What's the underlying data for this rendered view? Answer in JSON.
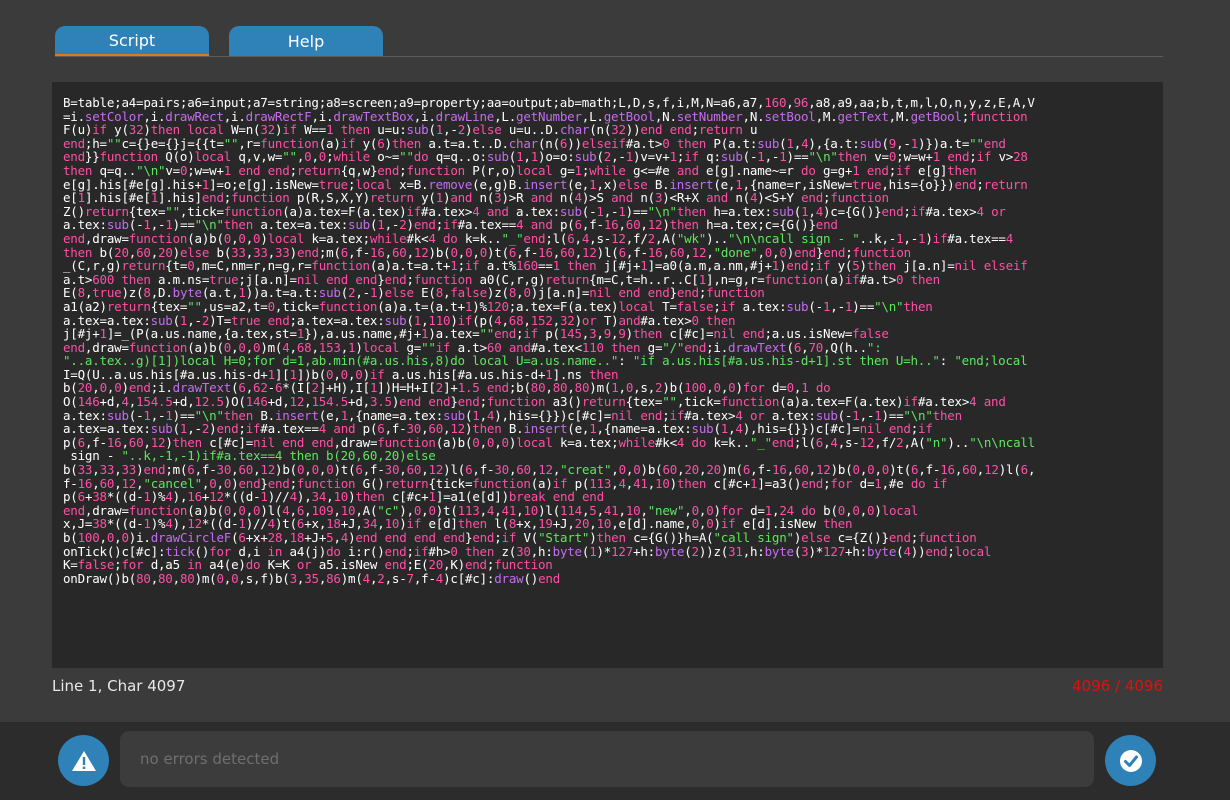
{
  "tabs": [
    {
      "label": "Script",
      "active": true
    },
    {
      "label": "Help",
      "active": false
    }
  ],
  "editor": {
    "lines": [
      "B=table;a4=pairs;a6=input;a7=string;a8=screen;a9=property;aa=output;ab=math;L,D,s,f,i,M,N=a6,a7,160,96,a8,a9,aa;b,t,m,l,O,n,y,z,E,A,V",
      "=i.setColor,i.drawRect,i.drawRectF,i.drawTextBox,i.drawLine,L.getNumber,L.getBool,N.setNumber,N.setBool,M.getText,M.getBool;function",
      "F(u)if y(32)then local W=n(32)if W==1 then u=u:sub(1,-2)else u=u..D.char(n(32))end end;return u",
      "end;h=\"\"c={}e={}j={{t=\"\",r=function(a)if y(6)then a.t=a.t..D.char(n(6))elseif#a.t>0 then P(a.t:sub(1,4),{a.t:sub(9,-1)})a.t=\"\"end",
      "end}}function Q(o)local q,v,w=\"\",0,0;while o~=\"\"do q=q..o:sub(1,1)o=o:sub(2,-1)v=v+1;if q:sub(-1,-1)==\"\\n\"then v=0;w=w+1 end;if v>28",
      "then q=q..\"\\n\"v=0;w=w+1 end end;return{q,w}end;function P(r,o)local g=1;while g<=#e and e[g].name~=r do g=g+1 end;if e[g]then",
      "e[g].his[#e[g].his+1]=o;e[g].isNew=true;local x=B.remove(e,g)B.insert(e,1,x)else B.insert(e,1,{name=r,isNew=true,his={o}})end;return",
      "e[1].his[#e[1].his]end;function p(R,S,X,Y)return y(1)and n(3)>R and n(4)>S and n(3)<R+X and n(4)<S+Y end;function",
      "Z()return{tex=\"\",tick=function(a)a.tex=F(a.tex)if#a.tex>4 and a.tex:sub(-1,-1)==\"\\n\"then h=a.tex:sub(1,4)c={G()}end;if#a.tex>4 or",
      "a.tex:sub(-1,-1)==\"\\n\"then a.tex=a.tex:sub(1,-2)end;if#a.tex==4 and p(6,f-16,60,12)then h=a.tex;c={G()}end",
      "end,draw=function(a)b(0,0,0)local k=a.tex;while#k<4 do k=k..\"_\"end;l(6,4,s-12,f/2,A(\"wk\")..\"\\n\\ncall sign - \"..k,-1,-1)if#a.tex==4",
      "then b(20,60,20)else b(33,33,33)end;m(6,f-16,60,12)b(0,0,0)t(6,f-16,60,12)l(6,f-16,60,12,\"done\",0,0)end}end;function",
      "_(C,r,g)return{t=0,m=C,nm=r,n=g,r=function(a)a.t=a.t+1;if a.t%160==1 then j[#j+1]=a0(a.m,a.nm,#j+1)end;if y(5)then j[a.n]=nil elseif",
      "a.t>600 then a.m.ns=true;j[a.n]=nil end end}end;function a0(C,r,g)return{m=C,t=h..r..C[1],n=g,r=function(a)if#a.t>0 then",
      "E(8,true)z(8,D.byte(a.t,1))a.t=a.t:sub(2,-1)else E(8,false)z(8,0)j[a.n]=nil end end}end;function",
      "a1(a2)return{tex=\"\",us=a2,t=0,tick=function(a)a.t=(a.t+1)%120;a.tex=F(a.tex)local T=false;if a.tex:sub(-1,-1)==\"\\n\"then",
      "a.tex=a.tex:sub(1,-2)T=true end;a.tex=a.tex:sub(1,110)if(p(4,68,152,32)or T)and#a.tex>0 then",
      "j[#j+1]=_(P(a.us.name,{a.tex,st=1}),a.us.name,#j+1)a.tex=\"\"end;if p(145,3,9,9)then c[#c]=nil end;a.us.isNew=false",
      "end,draw=function(a)b(0,0,0)m(4,68,153,1)local g=\"\"if a.t>60 and#a.tex<110 then g=\"/\"end;i.drawText(6,70,Q(h..\":",
      "\"..a.tex..g)[1])local H=0;for d=1,ab.min(#a.us.his,8)do local U=a.us.name..\": \"if a.us.his[#a.us.his-d+1].st then U=h..\": \"end;local",
      "I=Q(U..a.us.his[#a.us.his-d+1][1])b(0,0,0)if a.us.his[#a.us.his-d+1].ns then",
      "b(20,0,0)end;i.drawText(6,62-6*(I[2]+H),I[1])H=H+I[2]+1.5 end;b(80,80,80)m(1,0,s,2)b(100,0,0)for d=0,1 do",
      "O(146+d,4,154.5+d,12.5)O(146+d,12,154.5+d,3.5)end end}end;function a3()return{tex=\"\",tick=function(a)a.tex=F(a.tex)if#a.tex>4 and",
      "a.tex:sub(-1,-1)==\"\\n\"then B.insert(e,1,{name=a.tex:sub(1,4),his={}})c[#c]=nil end;if#a.tex>4 or a.tex:sub(-1,-1)==\"\\n\"then",
      "a.tex=a.tex:sub(1,-2)end;if#a.tex==4 and p(6,f-30,60,12)then B.insert(e,1,{name=a.tex:sub(1,4),his={}})c[#c]=nil end;if",
      "p(6,f-16,60,12)then c[#c]=nil end end,draw=function(a)b(0,0,0)local k=a.tex;while#k<4 do k=k..\"_\"end;l(6,4,s-12,f/2,A(\"n\")..\"\\n\\ncall",
      " sign - \"..k,-1,-1)if#a.tex==4 then b(20,60,20)else",
      "b(33,33,33)end;m(6,f-30,60,12)b(0,0,0)t(6,f-30,60,12)l(6,f-30,60,12,\"creat\",0,0)b(60,20,20)m(6,f-16,60,12)b(0,0,0)t(6,f-16,60,12)l(6,",
      "f-16,60,12,\"cancel\",0,0)end}end;function G()return{tick=function(a)if p(113,4,41,10)then c[#c+1]=a3()end;for d=1,#e do if",
      "p(6+38*((d-1)%4),16+12*((d-1)//4),34,10)then c[#c+1]=a1(e[d])break end end",
      "end,draw=function(a)b(0,0,0)l(4,6,109,10,A(\"c\"),0,0)t(113,4,41,10)l(114,5,41,10,\"new\",0,0)for d=1,24 do b(0,0,0)local",
      "x,J=38*((d-1)%4),12*((d-1)//4)t(6+x,18+J,34,10)if e[d]then l(8+x,19+J,20,10,e[d].name,0,0)if e[d].isNew then",
      "b(100,0,0)i.drawCircleF(6+x+28,18+J+5,4)end end end end}end;if V(\"Start\")then c={G()}h=A(\"call sign\")else c={Z()}end;function",
      "onTick()c[#c]:tick()for d,i in a4(j)do i:r()end;if#h>0 then z(30,h:byte(1)*127+h:byte(2))z(31,h:byte(3)*127+h:byte(4))end;local",
      "K=false;for d,a5 in a4(e)do K=K or a5.isNew end;E(20,K)end;function",
      "onDraw()b(80,80,80)m(0,0,s,f)b(3,35,86)m(4,2,s-7,f-4)c[#c]:draw()end"
    ]
  },
  "status": {
    "cursor": "Line 1, Char 4097",
    "char_count": "4096 / 4096"
  },
  "bottom": {
    "warn_icon": "warning-icon",
    "error_placeholder": "no errors detected",
    "ok_icon": "check-icon"
  },
  "colors": {
    "accent": "#2e82b8",
    "tab_underline": "#e07a1f",
    "keyword": "#ff4fa6",
    "function_name": "#c56cf0",
    "string": "#5ee75e",
    "limit_warning": "#e01010"
  }
}
